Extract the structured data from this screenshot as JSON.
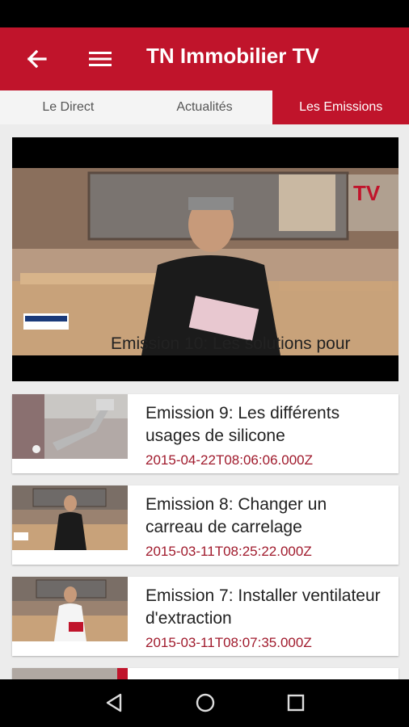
{
  "app": {
    "title": "TN Immobilier TV"
  },
  "tabs": [
    {
      "label": "Le Direct",
      "active": false
    },
    {
      "label": "Actualités",
      "active": false
    },
    {
      "label": "Les Emissions",
      "active": true
    }
  ],
  "featured": {
    "title": "Emission 10: Les solutions pour"
  },
  "items": [
    {
      "title": "Emission 9: Les différents usages de silicone",
      "date": "2015-04-22T08:06:06.000Z"
    },
    {
      "title": "Emission 8: Changer un carreau de carrelage",
      "date": "2015-03-11T08:25:22.000Z"
    },
    {
      "title": "Emission 7: Installer ventilateur d'extraction",
      "date": "2015-03-11T08:07:35.000Z"
    }
  ],
  "colors": {
    "accent": "#c0142b",
    "date": "#a01a2c",
    "background": "#ececec"
  },
  "icons": {
    "back": "arrow-back-icon",
    "menu": "hamburger-menu-icon",
    "nav_back": "triangle-back-icon",
    "nav_home": "circle-home-icon",
    "nav_recents": "square-recents-icon"
  }
}
